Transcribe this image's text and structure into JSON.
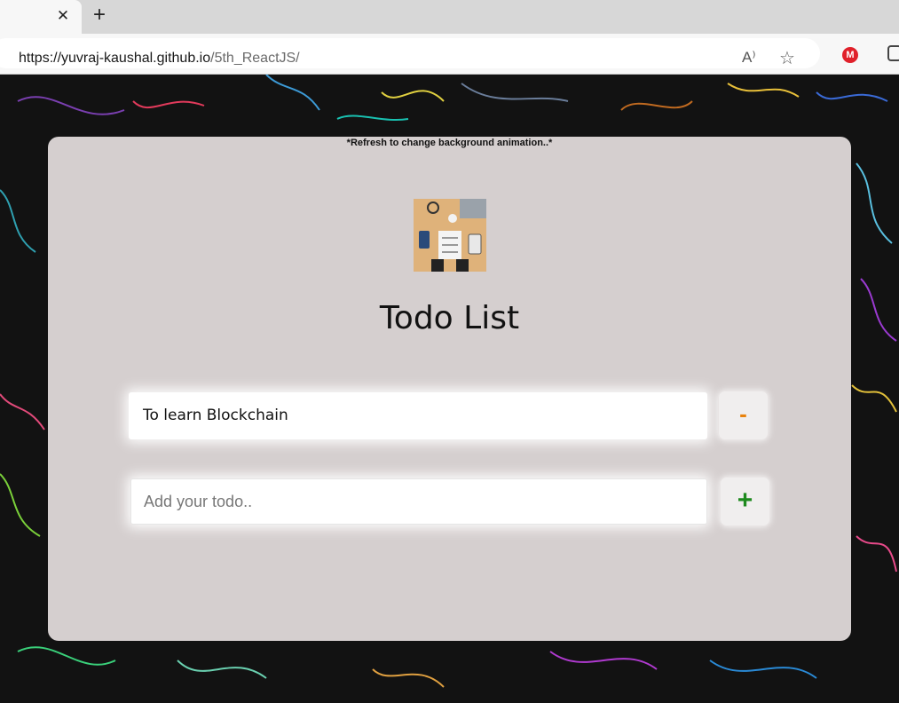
{
  "browser": {
    "tab_close_glyph": "✕",
    "new_tab_glyph": "+",
    "url_host": "https://yuvraj-kaushal.github.io",
    "url_path": "/5th_ReactJS/",
    "read_aloud_glyph": "A⁾",
    "favorites_glyph": "☆",
    "extension_letter": "M",
    "icons": [
      "lock-icon",
      "read-aloud-icon",
      "add-favorite-icon",
      "extension-m-icon",
      "extensions-puzzle-icon"
    ]
  },
  "app": {
    "refresh_note": "*Refresh to change background animation..*",
    "title": "Todo List",
    "todos": [
      "To learn Blockchain"
    ],
    "remove_label": "-",
    "add_label": "+",
    "add_placeholder": "Add your todo..",
    "colors": {
      "card": "#d5cfcf",
      "remove": "#e8820c",
      "add": "#1e8a1e",
      "background": "#121212"
    }
  }
}
